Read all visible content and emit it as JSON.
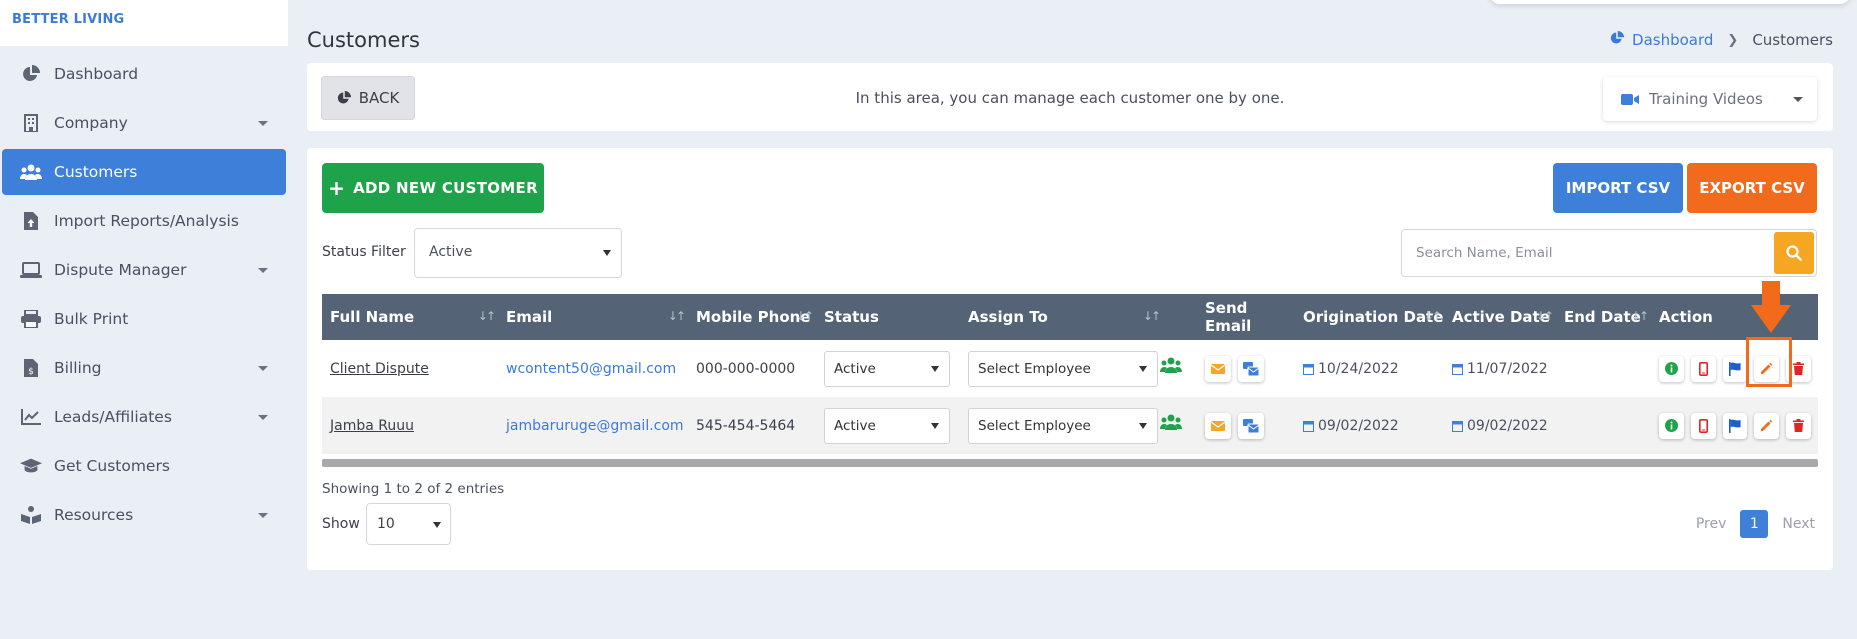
{
  "app": {
    "brand": "BETTER LIVING"
  },
  "sidebar": {
    "items": [
      {
        "label": "Dashboard",
        "icon": "pie-chart-icon",
        "has_caret": false
      },
      {
        "label": "Company",
        "icon": "building-icon",
        "has_caret": true
      },
      {
        "label": "Customers",
        "icon": "users-icon",
        "has_caret": false,
        "active": true
      },
      {
        "label": "Import Reports/Analysis",
        "icon": "file-upload-icon",
        "has_caret": false
      },
      {
        "label": "Dispute Manager",
        "icon": "laptop-icon",
        "has_caret": true
      },
      {
        "label": "Bulk Print",
        "icon": "printer-icon",
        "has_caret": false
      },
      {
        "label": "Billing",
        "icon": "invoice-icon",
        "has_caret": true
      },
      {
        "label": "Leads/Affiliates",
        "icon": "chart-line-icon",
        "has_caret": true
      },
      {
        "label": "Get Customers",
        "icon": "graduation-cap-icon",
        "has_caret": false
      },
      {
        "label": "Resources",
        "icon": "book-reader-icon",
        "has_caret": true
      }
    ]
  },
  "header": {
    "title": "Customers",
    "breadcrumb": {
      "home": "Dashboard",
      "current": "Customers"
    }
  },
  "topbar": {
    "back_label": "BACK",
    "message": "In this area, you can manage each customer one by one.",
    "training_label": "Training Videos"
  },
  "toolbar": {
    "add_label": "ADD NEW CUSTOMER",
    "import_label": "IMPORT CSV",
    "export_label": "EXPORT CSV",
    "status_filter_label": "Status Filter",
    "status_filter_value": "Active",
    "search_placeholder": "Search Name, Email"
  },
  "table": {
    "columns": [
      "Full Name",
      "Email",
      "Mobile Phone",
      "Status",
      "Assign To",
      "Send Email",
      "Origination Date",
      "Active Date",
      "End Date",
      "Action"
    ],
    "rows": [
      {
        "name": "Client Dispute",
        "email": "wcontent50@gmail.com",
        "phone": "000-000-0000",
        "status": "Active",
        "assign": "Select Employee",
        "origination": "10/24/2022",
        "active_date": "11/07/2022",
        "end_date": ""
      },
      {
        "name": "Jamba Ruuu",
        "email": "jambaruruge@gmail.com",
        "phone": "545-454-5464",
        "status": "Active",
        "assign": "Select Employee",
        "origination": "09/02/2022",
        "active_date": "09/02/2022",
        "end_date": ""
      }
    ]
  },
  "footer": {
    "showing": "Showing 1 to 2 of 2 entries",
    "show_label": "Show",
    "page_size": "10",
    "prev": "Prev",
    "current_page": "1",
    "next": "Next"
  },
  "colors": {
    "accent": "#3d7fd9",
    "success": "#1fa34a",
    "warning": "#f5a623",
    "orange": "#f26a1b",
    "header": "#556377"
  }
}
